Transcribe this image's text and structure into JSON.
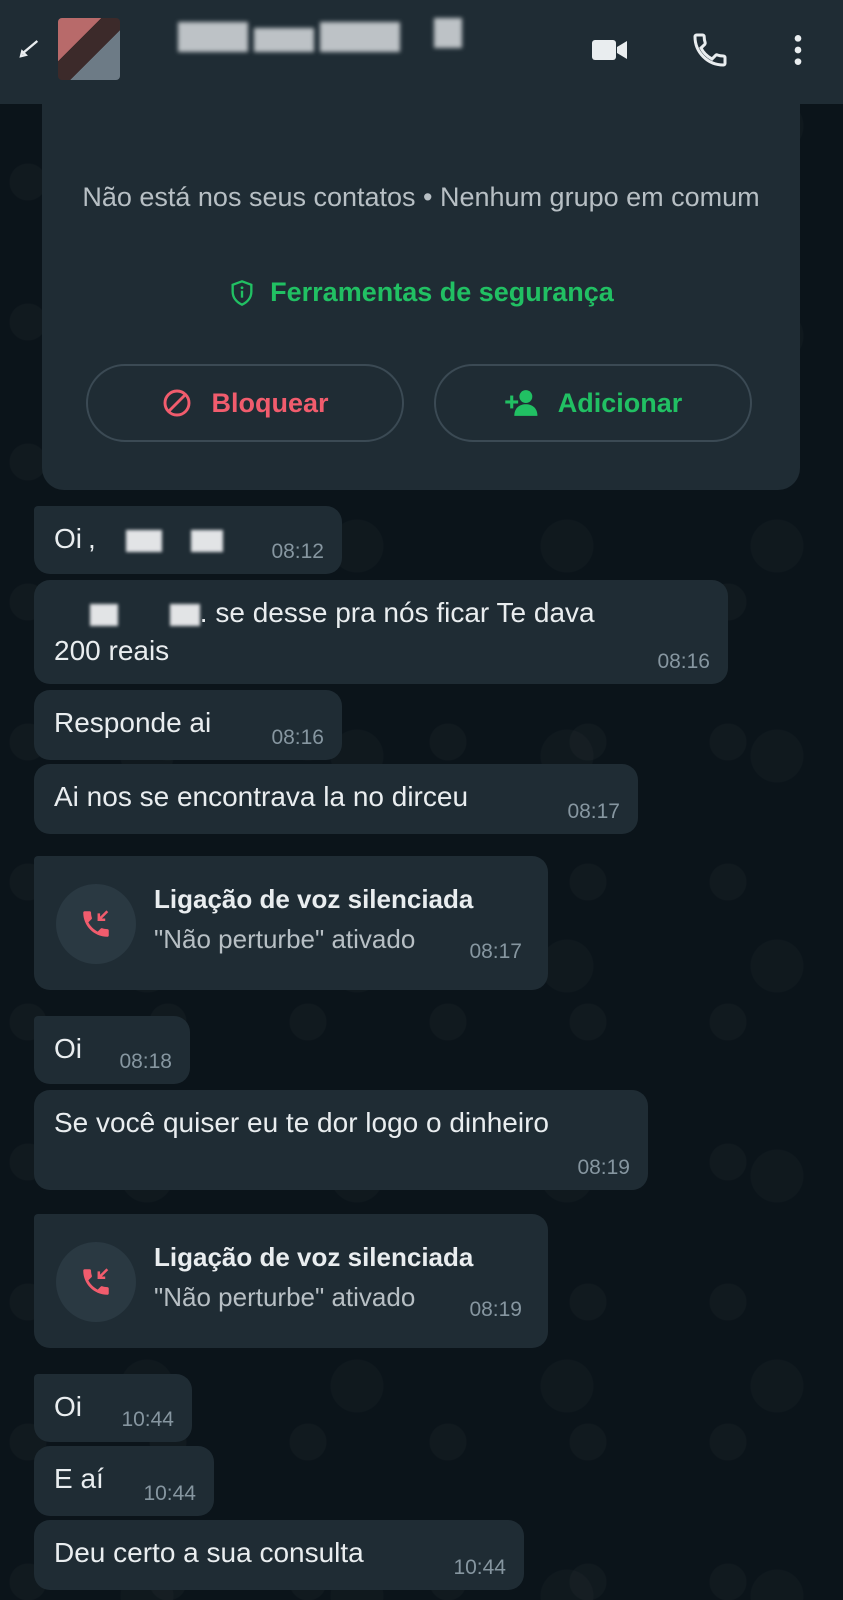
{
  "header": {
    "back_icon": "back-arrow-icon",
    "video_icon": "video-camera-icon",
    "call_icon": "phone-icon",
    "menu_icon": "more-vertical-icon"
  },
  "info_card": {
    "text": "Não está nos seus contatos • Nenhum grupo em comum",
    "safety_link": "Ferramentas de segurança",
    "block_label": "Bloquear",
    "add_label": "Adicionar"
  },
  "messages": [
    {
      "text": "Oi",
      "time": "08:12"
    },
    {
      "text_line1": ". se desse pra nós ficar Te dava",
      "text_line2": "200 reais",
      "time": "08:16"
    },
    {
      "text": "Responde ai",
      "time": "08:16"
    },
    {
      "text": "Ai nos se encontrava la no dirceu",
      "time": "08:17"
    },
    {
      "call_title": "Ligação de voz silenciada",
      "call_sub": "\"Não perturbe\" ativado",
      "time": "08:17"
    },
    {
      "text": "Oi",
      "time": "08:18"
    },
    {
      "text": "Se você quiser eu te dor logo o dinheiro",
      "time": "08:19"
    },
    {
      "call_title": "Ligação de voz silenciada",
      "call_sub": "\"Não perturbe\" ativado",
      "time": "08:19"
    },
    {
      "text": "Oi",
      "time": "10:44"
    },
    {
      "text": "E aí",
      "time": "10:44"
    },
    {
      "text": "Deu certo a sua consulta",
      "time": "10:44"
    }
  ],
  "colors": {
    "background": "#0b141a",
    "bubble": "#1f2c34",
    "accent_green": "#21c063",
    "danger_red": "#f15c6d",
    "timestamp": "#8696a0"
  }
}
